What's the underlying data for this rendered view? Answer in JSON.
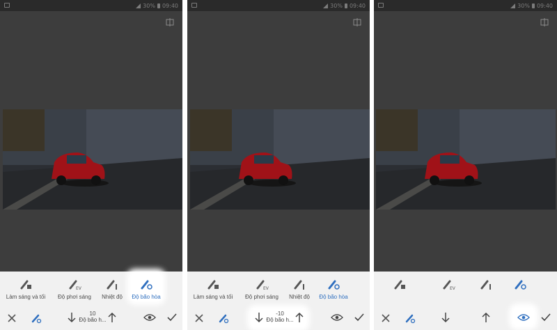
{
  "status": {
    "battery": "30%",
    "time": "09:40"
  },
  "tools": [
    {
      "label": "Làm sáng và tối",
      "icon": "brush-light-icon"
    },
    {
      "label": "Độ phơi sáng",
      "icon": "brush-ev-icon"
    },
    {
      "label": "Nhiệt độ",
      "icon": "brush-temperature-icon"
    },
    {
      "label": "Độ bão hòa",
      "icon": "brush-saturation-icon"
    }
  ],
  "panels": [
    {
      "value": "10",
      "value_label": "Độ bão h..."
    },
    {
      "value": "-10",
      "value_label": "Độ bão h..."
    },
    {
      "value": "",
      "value_label": ""
    }
  ],
  "colors": {
    "accent": "#2f6fbf",
    "car": "#c0141a"
  }
}
